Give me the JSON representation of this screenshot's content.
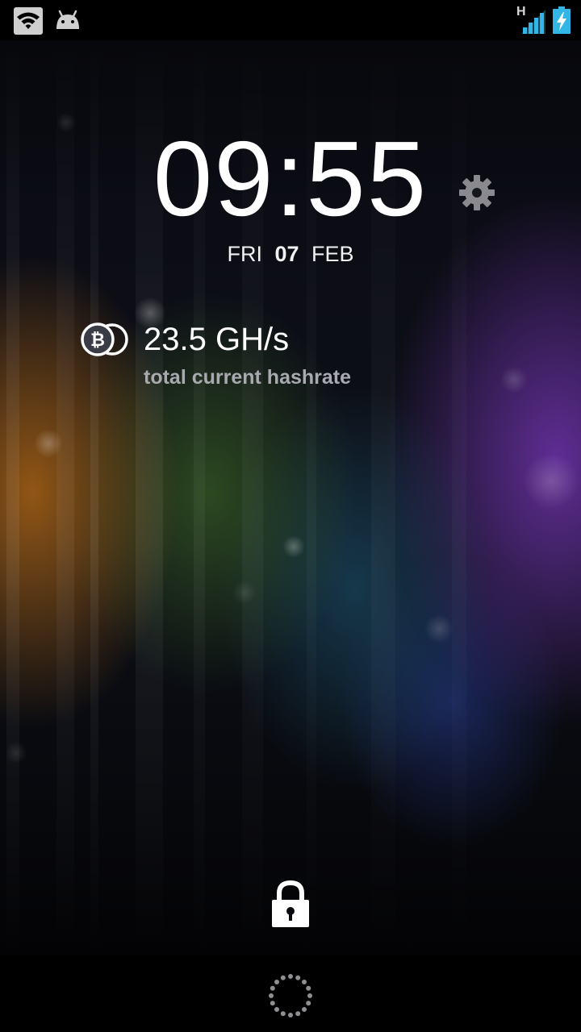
{
  "status_bar": {
    "icons": [
      "wifi-icon",
      "android-icon",
      "signal-icon",
      "battery-charging-icon"
    ],
    "network_type": "H",
    "accent_color": "#33b5e5"
  },
  "lockscreen": {
    "clock": {
      "hours": "09",
      "separator": ":",
      "minutes": "55"
    },
    "date": {
      "weekday": "FRI",
      "day": "07",
      "month": "FEB"
    },
    "settings_icon": "gear-icon"
  },
  "widget": {
    "icon": "bitcoin-icon",
    "value": "23.5 GH/s",
    "label": "total current hashrate"
  },
  "unlock": {
    "icon": "lock-icon"
  },
  "nav_bar": {
    "icon": "loading-dots-icon"
  }
}
